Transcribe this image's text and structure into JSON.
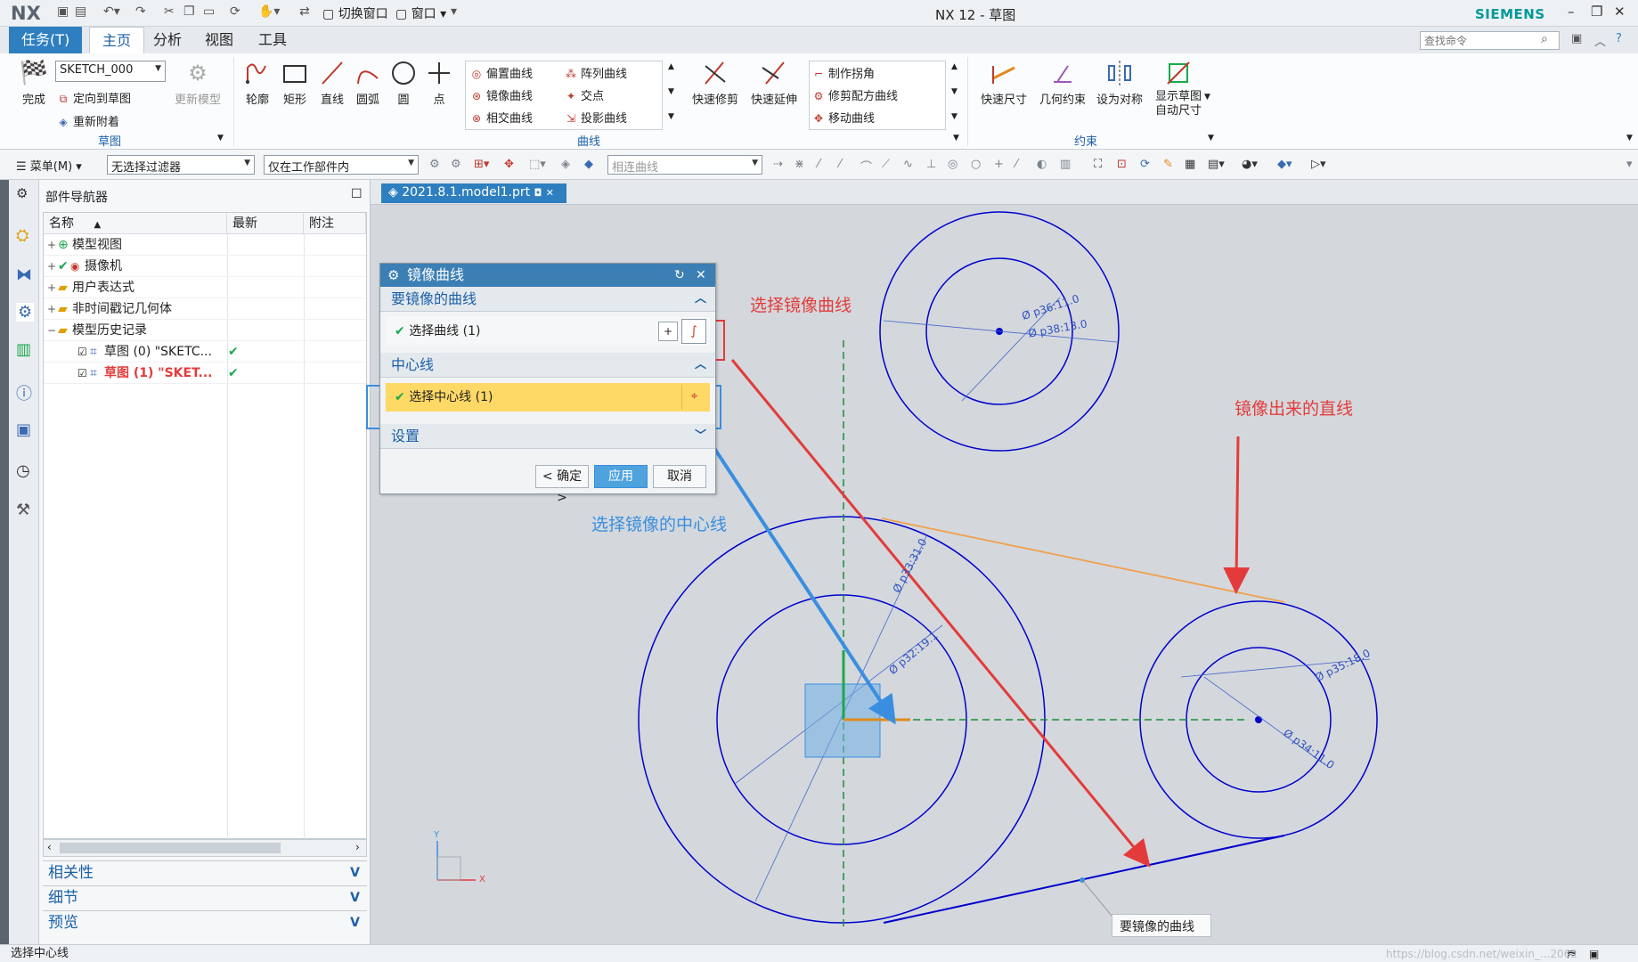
{
  "window": {
    "app_logo": "NX",
    "title": "NX 12 - 草图",
    "brand": "SIEMENS",
    "quick_access": [
      "切换窗口",
      "窗口"
    ]
  },
  "ribbon_tabs": [
    "任务(T)",
    "主页",
    "分析",
    "视图",
    "工具"
  ],
  "search_placeholder": "查找命令",
  "ribbon": {
    "finish_label": "完成",
    "sketch_name": "SKETCH_000",
    "orient_label": "定向到草图",
    "reattach_label": "重新附着",
    "update_model_label": "更新模型",
    "group_sketch": "草图",
    "tools": [
      "轮廓",
      "矩形",
      "直线",
      "圆弧",
      "圆",
      "点"
    ],
    "curve_items": [
      "偏置曲线",
      "镜像曲线",
      "相交曲线",
      "阵列曲线",
      "交点",
      "投影曲线"
    ],
    "quick_trim": "快速修剪",
    "quick_extend": "快速延伸",
    "edit_items": [
      "制作拐角",
      "修剪配方曲线",
      "移动曲线"
    ],
    "group_curve": "曲线",
    "constraint_tools": [
      "快速尺寸",
      "几何约束",
      "设为对称"
    ],
    "show_dims_line1": "显示草图",
    "show_dims_line2": "自动尺寸",
    "group_constraint": "约束"
  },
  "toolbar2": {
    "menu_label": "菜单(M)",
    "filter": "无选择过滤器",
    "scope": "仅在工作部件内",
    "curve_rule": "相连曲线"
  },
  "navigator": {
    "title": "部件导航器",
    "columns": [
      "名称",
      "最新",
      "附注"
    ],
    "rows": [
      {
        "label": "模型视图",
        "highlight": false,
        "tick": ""
      },
      {
        "label": "摄像机",
        "highlight": false,
        "tick": ""
      },
      {
        "label": "用户表达式",
        "highlight": false,
        "tick": ""
      },
      {
        "label": "非时间戳记几何体",
        "highlight": false,
        "tick": ""
      },
      {
        "label": "模型历史记录",
        "highlight": false,
        "tick": ""
      },
      {
        "label": "草图 (0) \"SKETC...",
        "highlight": false,
        "tick": "✔"
      },
      {
        "label": "草图 (1) \"SKET...",
        "highlight": true,
        "tick": "✔"
      }
    ],
    "panels": [
      "相关性",
      "细节",
      "预览"
    ]
  },
  "part_tab": "2021.8.1.model1.prt",
  "dialog": {
    "title": "镜像曲线",
    "section_curve": "要镜像的曲线",
    "select_curve": "选择曲线 (1)",
    "section_center": "中心线",
    "select_center": "选择中心线 (1)",
    "section_settings": "设置",
    "btn_ok": "< 确定 >",
    "btn_apply": "应用",
    "btn_cancel": "取消"
  },
  "annotations": {
    "select_mirror_curve": "选择镜像曲线",
    "mirrored_line": "镜像出来的直线",
    "select_center_line": "选择镜像的中心线",
    "curve_to_mirror": "要镜像的曲线"
  },
  "dimensions": [
    "Ø p36:11.0",
    "Ø p38:13.0",
    "Ø p33:31.0",
    "Ø p32:19.1",
    "Ø p35:18.0",
    "Ø p34:11.0"
  ],
  "axis_labels": {
    "y": "Y",
    "x": "X"
  },
  "status_text": "选择中心线",
  "watermark": "https://blog.csdn.net/weixin_...2062",
  "colors": {
    "accent": "#2e7fc0",
    "sketch_curve": "#0000cc",
    "annotation_red": "#e33b3b",
    "annotation_blue": "#3a8ee0",
    "highlight_yellow": "#ffd966",
    "mirror_line": "#f0a050"
  }
}
